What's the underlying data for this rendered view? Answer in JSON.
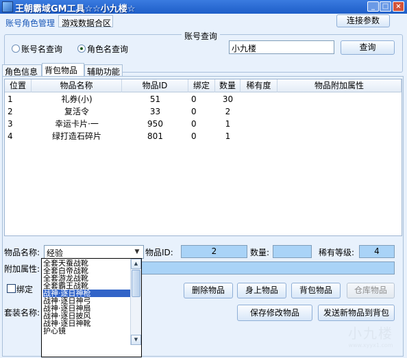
{
  "window": {
    "title": "王朝霸域GM工具☆☆小九楼☆",
    "controls": {
      "minimize": "_",
      "maximize": "□",
      "close": "×"
    }
  },
  "top_tabs": [
    "账号角色管理",
    "游戏数据合区"
  ],
  "connect_button": "连接参数",
  "account_query": {
    "group_label": "账号查询",
    "options": [
      "账号名查询",
      "角色名查询"
    ],
    "selected_option": "角色名查询",
    "input_value": "小九楼",
    "query_button": "查询"
  },
  "sub_tabs": [
    "角色信息",
    "背包物品",
    "辅助功能"
  ],
  "active_sub_tab": "背包物品",
  "table": {
    "columns": [
      "位置",
      "物品名称",
      "物品ID",
      "绑定",
      "数量",
      "稀有度",
      "物品附加属性"
    ],
    "rows": [
      [
        "1",
        "礼券(小)",
        "51",
        "0",
        "30",
        "",
        ""
      ],
      [
        "2",
        "复活令",
        "33",
        "0",
        "2",
        "",
        ""
      ],
      [
        "3",
        "幸运卡片·一",
        "950",
        "0",
        "1",
        "",
        ""
      ],
      [
        "4",
        "绿打造石碎片",
        "801",
        "0",
        "1",
        "",
        ""
      ]
    ]
  },
  "form": {
    "item_name_label": "物品名称:",
    "item_name_value": "经验",
    "item_id_label": "物品ID:",
    "item_id_value": "2",
    "quantity_label": "数量:",
    "quantity_value": "",
    "rarity_label": "稀有等级:",
    "rarity_value": "4",
    "attr_label": "附加属性:",
    "bind_label": "绑定",
    "set_name_label": "套装名称:"
  },
  "dropdown_options": [
    "全套天蚕战靴",
    "全套白帝战靴",
    "全套游龙战靴",
    "全套霸王战靴",
    "战神·逐日神枪",
    "战神·逐日神弓",
    "战神·逐日神扇",
    "战神·逐日披风",
    "战神·逐日神靴",
    "护心镜"
  ],
  "dropdown_selected": "战神·逐日神枪",
  "buttons": {
    "delete": "删除物品",
    "body_items": "身上物品",
    "bag_items": "背包物品",
    "warehouse_items": "仓库物品",
    "save_edit": "保存修改物品",
    "send_new": "发送新物品到背包"
  },
  "watermark": {
    "main": "小九楼",
    "sub": "www.xyyx1.com"
  },
  "colors": {
    "titlebar": "#1e5ec8",
    "client": "#e8f1fc",
    "highlight": "#3264c8",
    "numbox": "#a9d3f7"
  }
}
